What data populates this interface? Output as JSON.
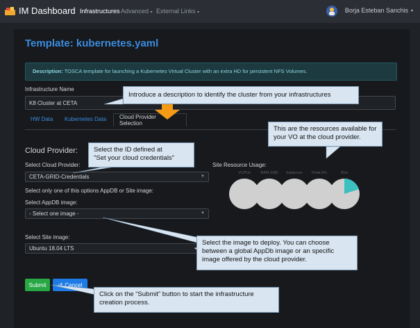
{
  "navbar": {
    "brand": "IM Dashboard",
    "links": [
      "Infrastructures",
      "Advanced",
      "External Links"
    ],
    "user": "Borja Esteban Sanchis"
  },
  "page": {
    "title": "Template: kubernetes.yaml",
    "description_label": "Description:",
    "description_text": "TOSCA template for launching a Kubernetes Virtual Cluster with an extra HD for persistent NFS Volumes."
  },
  "form": {
    "infra_name_label": "Infrastructure Name",
    "infra_name_value": "K8 Cluster at CETA",
    "tabs": [
      "HW Data",
      "Kubernetes Data",
      "Cloud Provider Selection"
    ],
    "section_title": "Cloud Provider:",
    "cloud_label": "Select Cloud Provider:",
    "cloud_value": "CETA-GRID-Credentials",
    "only_one_note": "Select only one of this options AppDB or Site image:",
    "appdb_label": "Select AppDB image:",
    "appdb_value": "- Select one image -",
    "site_label": "Select Site image:",
    "site_value": "Ubuntu 18.04 LTS",
    "submit_label": "Submit",
    "cancel_label": "Cancel"
  },
  "usage": {
    "title": "Site Resource Usage:",
    "labels": [
      "VCPUs",
      "RAM (GB)",
      "Instances",
      "Float IPs",
      "SGs"
    ],
    "fractions": [
      0,
      0,
      0,
      0,
      0.2
    ],
    "base_color": "#d0d0d0",
    "used_color": "#3bbfbf"
  },
  "callouts": {
    "description": "Introduce a description to identify the cluster from your infrastructures",
    "resources": "This are the resources available for your VO at the cloud provider.",
    "credentials_line1": "Select the ID defined at",
    "credentials_line2": "\"Set your cloud credentials\"",
    "image": "Select the image to deploy. You can choose between a global AppDb image or an specific image offered by the cloud provider.",
    "submit": "Click on the “Submit” button to start the infrastructure creation process."
  },
  "colors": {
    "accent": "#3c8cde",
    "submit": "#28a745",
    "cancel": "#1e7be6",
    "callout_bg": "#d9e6f2",
    "arrow": "#f49a17"
  }
}
